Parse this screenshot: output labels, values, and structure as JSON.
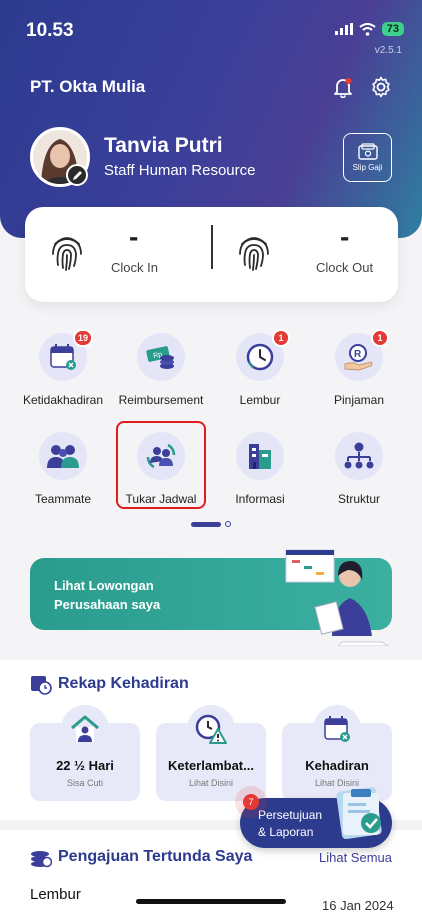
{
  "status_bar": {
    "time": "10.53",
    "battery": "73"
  },
  "app": {
    "version": "v2.5.1",
    "company": "PT. Okta Mulia"
  },
  "user": {
    "name": "Tanvia Putri",
    "role": "Staff Human Resource"
  },
  "slip_button": {
    "label": "Slip Gaji"
  },
  "clock": {
    "clock_in": {
      "value": "-",
      "label": "Clock In"
    },
    "clock_out": {
      "value": "-",
      "label": "Clock Out"
    }
  },
  "menu": [
    {
      "label": "Ketidakhadiran",
      "icon": "calendar-cross-icon",
      "badge": "19"
    },
    {
      "label": "Reimbursement",
      "icon": "money-coins-icon",
      "badge": ""
    },
    {
      "label": "Lembur",
      "icon": "clock-icon",
      "badge": "1"
    },
    {
      "label": "Pinjaman",
      "icon": "hand-coin-icon",
      "badge": "1"
    },
    {
      "label": "Teammate",
      "icon": "team-icon",
      "badge": ""
    },
    {
      "label": "Tukar Jadwal",
      "icon": "swap-people-icon",
      "badge": ""
    },
    {
      "label": "Informasi",
      "icon": "building-icon",
      "badge": ""
    },
    {
      "label": "Struktur",
      "icon": "org-chart-icon",
      "badge": ""
    }
  ],
  "banner": {
    "line1": "Lihat Lowongan",
    "line2": "Perusahaan saya"
  },
  "rekap": {
    "title": "Rekap Kehadiran",
    "cards": [
      {
        "title": "22 ½ Hari",
        "subtitle": "Sisa Cuti"
      },
      {
        "title": "Keterlambat...",
        "subtitle": "Lihat Disini"
      },
      {
        "title": "Kehadiran",
        "subtitle": "Lihat Disini"
      }
    ]
  },
  "fab": {
    "line1": "Persetujuan",
    "line2": "& Laporan",
    "badge": "7"
  },
  "pending": {
    "title": "Pengajuan Tertunda Saya",
    "see_all": "Lihat Semua",
    "first_item": {
      "title": "Lembur",
      "date": "16 Jan 2024"
    }
  },
  "colors": {
    "primary": "#2d3b8f",
    "teal": "#2a9c8e",
    "badge": "#e53935",
    "highlight": "#e01c1c"
  }
}
